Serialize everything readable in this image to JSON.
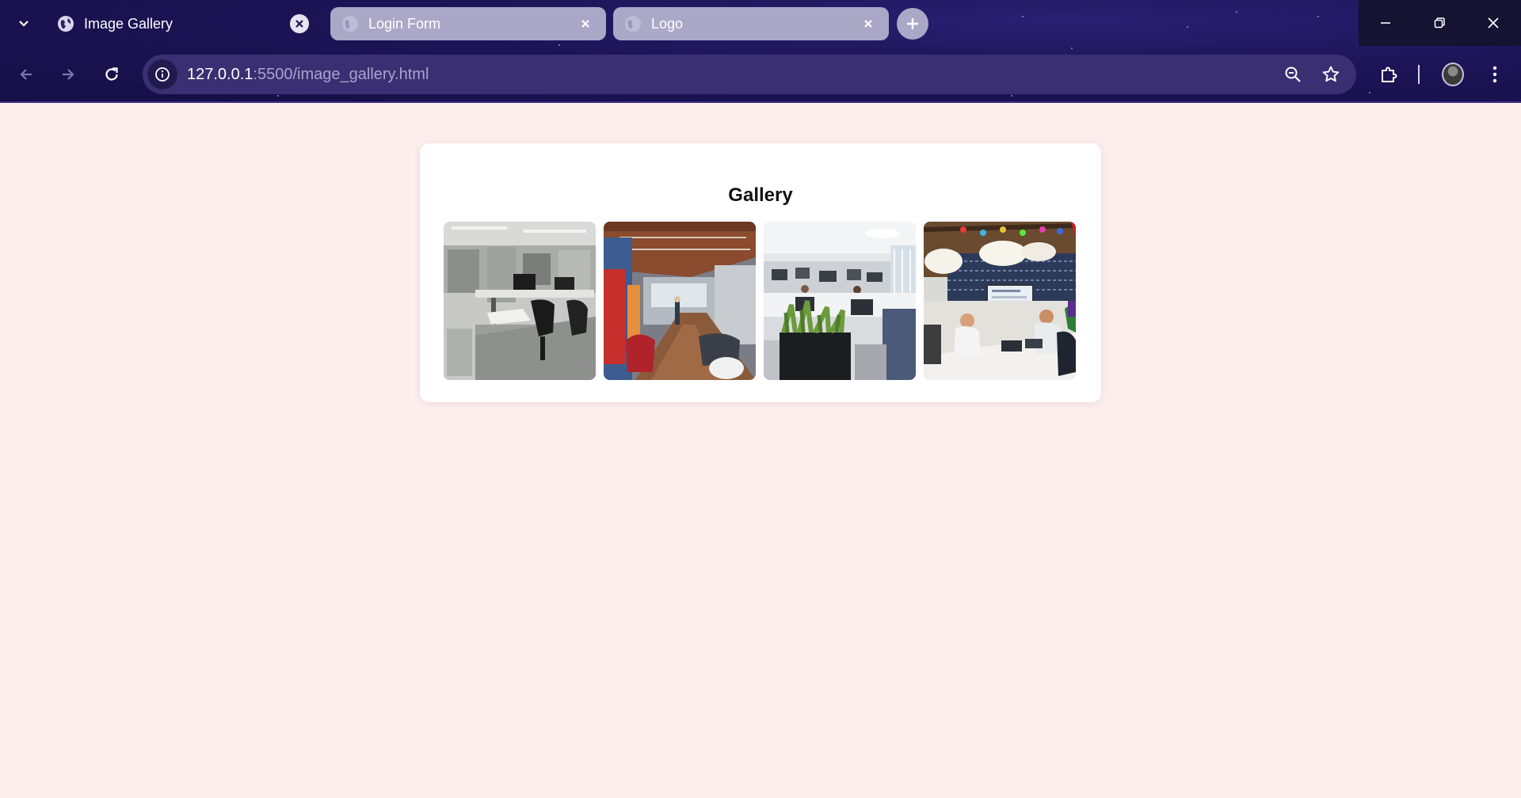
{
  "browser": {
    "tabs": [
      {
        "title": "Image Gallery",
        "active": true
      },
      {
        "title": "Login Form",
        "active": false
      },
      {
        "title": "Logo",
        "active": false
      }
    ],
    "url_host": "127.0.0.1",
    "url_path": ":5500/image_gallery.html"
  },
  "page": {
    "title": "Gallery",
    "images": [
      {
        "name": "office-photo-1",
        "icon": "photo"
      },
      {
        "name": "office-photo-2",
        "icon": "photo"
      },
      {
        "name": "office-photo-3",
        "icon": "photo"
      },
      {
        "name": "office-photo-4",
        "icon": "photo"
      }
    ]
  },
  "colors": {
    "chrome_bg": "#1c1456",
    "omnibox_bg": "#3b2f73",
    "inactive_tab": "#a9a8c7",
    "page_bg": "#fdeded",
    "card_bg": "#ffffff"
  }
}
